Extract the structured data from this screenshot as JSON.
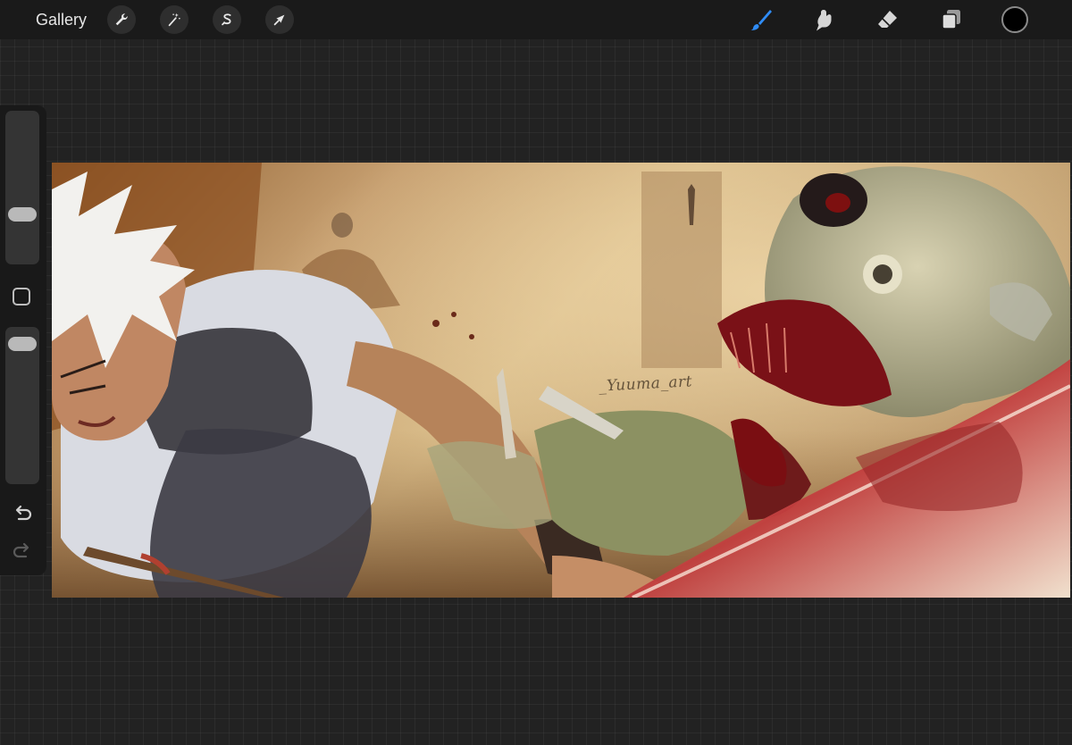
{
  "app": {
    "gallery_label": "Gallery"
  },
  "toolbar_left": [
    "wrench-icon",
    "magic-wand-icon",
    "selection-s-icon",
    "transform-arrow-icon"
  ],
  "toolbar_right": [
    "brush-icon",
    "smudge-icon",
    "eraser-icon",
    "layers-icon"
  ],
  "active_tool": "brush",
  "colors": {
    "accent": "#2f8cf6",
    "current_color": "#000000",
    "background": "#222222",
    "toolbar": "#1a1a1a"
  },
  "sidebar": {
    "brush_size_level": 0.3,
    "opacity_level": 0.95
  },
  "canvas": {
    "signature": "_Yuuma_art"
  }
}
